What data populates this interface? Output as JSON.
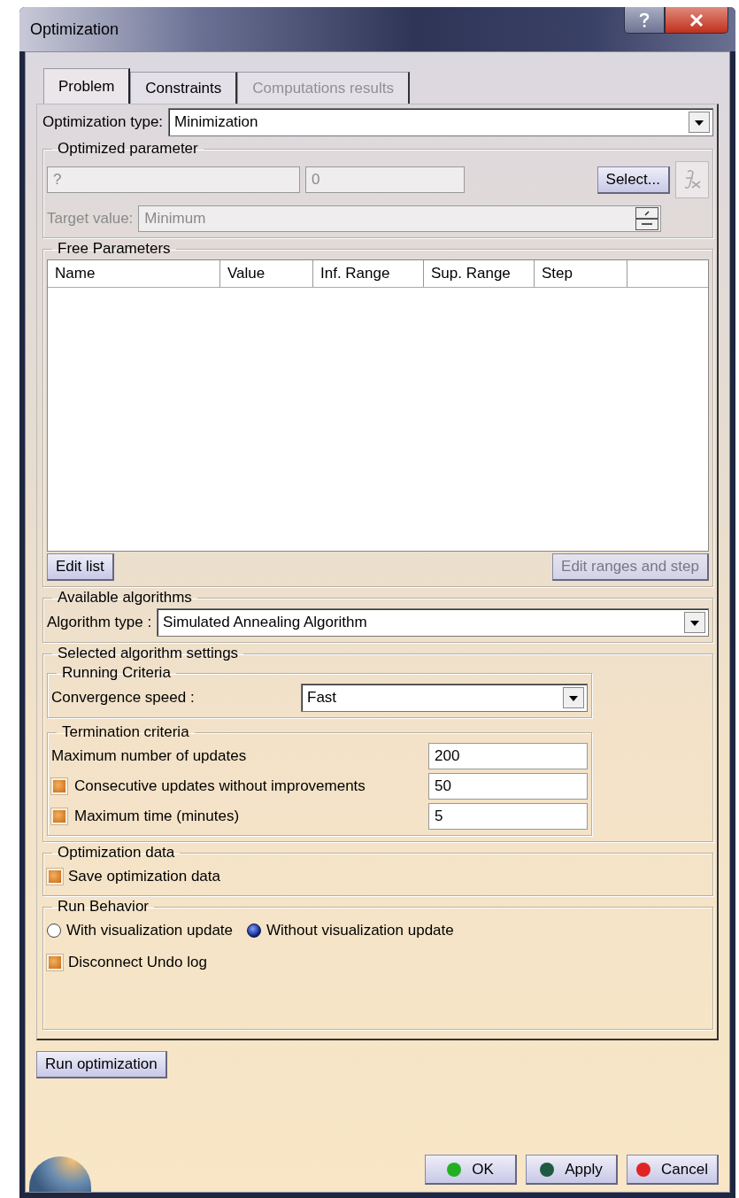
{
  "window": {
    "title": "Optimization"
  },
  "tabs": [
    {
      "label": "Problem",
      "selected": true,
      "disabled": false
    },
    {
      "label": "Constraints",
      "selected": false,
      "disabled": false
    },
    {
      "label": "Computations results",
      "selected": false,
      "disabled": true
    }
  ],
  "optimization_type": {
    "label": "Optimization type:",
    "value": "Minimization"
  },
  "optimized_parameter": {
    "title": "Optimized parameter",
    "disabled": true,
    "parameter": "?",
    "parameter_number": "0",
    "select_button": "Select...",
    "target_label": "Target value:",
    "target_value": "Minimum"
  },
  "free_parameters": {
    "title": "Free Parameters",
    "columns": [
      "Name",
      "Value",
      "Inf. Range",
      "Sup. Range",
      "Step"
    ],
    "buttons": [
      {
        "label": "Edit list",
        "disabled": false
      },
      {
        "label": "Edit ranges and step",
        "disabled": true
      }
    ]
  },
  "available_algorithms": {
    "title": "Available algorithms",
    "label": "Algorithm type :",
    "value": "Simulated Annealing Algorithm"
  },
  "algorithm_settings": {
    "title": "Selected algorithm settings",
    "running_criteria": {
      "title": "Running Criteria",
      "label": "Convergence speed :",
      "value": "Fast"
    },
    "termination_criteria": {
      "title": "Termination criteria",
      "rows": [
        {
          "kind": "plain",
          "label": "Maximum number of updates",
          "value": "200"
        },
        {
          "kind": "checkbox",
          "checked": true,
          "label": "Consecutive updates without improvements",
          "value": "50"
        },
        {
          "kind": "checkbox",
          "checked": true,
          "label": "Maximum time (minutes)",
          "value": "5"
        }
      ]
    }
  },
  "optimization_data": {
    "title": "Optimization data",
    "options": [
      {
        "label": "Save optimization data",
        "checked": true
      }
    ]
  },
  "run_behavior": {
    "title": "Run Behavior",
    "modes": [
      {
        "label": "With visualization update",
        "selected": false
      },
      {
        "label": "Without visualization update",
        "selected": true
      }
    ],
    "options": [
      {
        "label": "Disconnect Undo log",
        "checked": true
      }
    ]
  },
  "run_button": "Run optimization",
  "buttons": [
    {
      "label": "OK",
      "color": "#22b022"
    },
    {
      "label": "Apply",
      "color": "#1f5a40"
    },
    {
      "label": "Cancel",
      "color": "#e02424"
    }
  ]
}
